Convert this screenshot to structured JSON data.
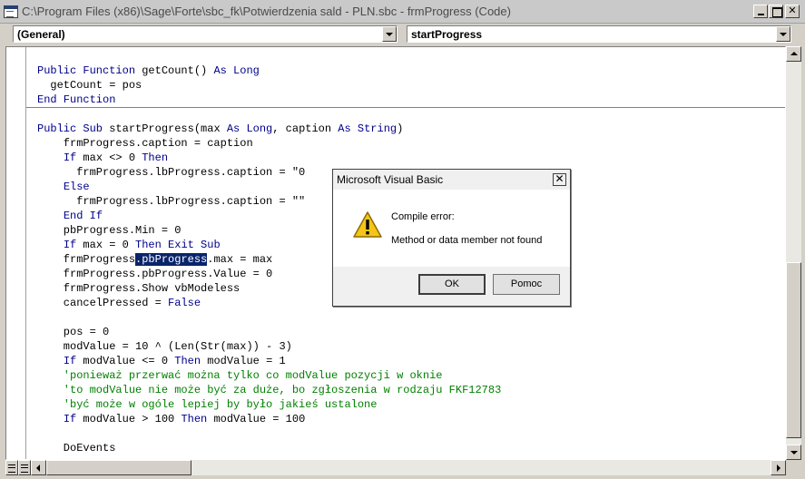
{
  "window": {
    "title": "C:\\Program Files (x86)\\Sage\\Forte\\sbc_fk\\Potwierdzenia sald - PLN.sbc - frmProgress (Code)",
    "buttons": {
      "minimize": "minimize-icon",
      "maximize": "maximize-icon",
      "close": "✕"
    }
  },
  "toolbar": {
    "object_combo": "(General)",
    "procedure_combo": "startProgress"
  },
  "code": {
    "lines": [
      [
        {
          "t": "Public Function ",
          "c": "kw"
        },
        {
          "t": "getCount() "
        },
        {
          "t": "As Long",
          "c": "kw"
        }
      ],
      [
        {
          "t": "  getCount = pos"
        }
      ],
      [
        {
          "t": "End Function",
          "c": "kw"
        }
      ],
      [
        {
          "t": ""
        }
      ],
      [
        {
          "t": "Public Sub ",
          "c": "kw"
        },
        {
          "t": "startProgress(max "
        },
        {
          "t": "As Long",
          "c": "kw"
        },
        {
          "t": ", caption "
        },
        {
          "t": "As String",
          "c": "kw"
        },
        {
          "t": ")"
        }
      ],
      [
        {
          "t": "    frmProgress.caption = caption"
        }
      ],
      [
        {
          "t": "    "
        },
        {
          "t": "If",
          "c": "kw"
        },
        {
          "t": " max <> 0 "
        },
        {
          "t": "Then",
          "c": "kw"
        }
      ],
      [
        {
          "t": "      frmProgress.lbProgress.caption = \"0"
        }
      ],
      [
        {
          "t": "    "
        },
        {
          "t": "Else",
          "c": "kw"
        }
      ],
      [
        {
          "t": "      frmProgress.lbProgress.caption = \"\""
        }
      ],
      [
        {
          "t": "    "
        },
        {
          "t": "End If",
          "c": "kw"
        }
      ],
      [
        {
          "t": "    pbProgress.Min = 0"
        }
      ],
      [
        {
          "t": "    "
        },
        {
          "t": "If",
          "c": "kw"
        },
        {
          "t": " max = 0 "
        },
        {
          "t": "Then Exit Sub",
          "c": "kw"
        }
      ],
      [
        {
          "t": "    frmProgress"
        },
        {
          "t": ".pbProgress",
          "c": "sel"
        },
        {
          "t": ".max = max"
        }
      ],
      [
        {
          "t": "    frmProgress.pbProgress.Value = 0"
        }
      ],
      [
        {
          "t": "    frmProgress.Show vbModeless"
        }
      ],
      [
        {
          "t": "    cancelPressed = "
        },
        {
          "t": "False",
          "c": "kw"
        }
      ],
      [
        {
          "t": ""
        }
      ],
      [
        {
          "t": "    pos = 0"
        }
      ],
      [
        {
          "t": "    modValue = 10 ^ (Len(Str(max)) - 3)"
        }
      ],
      [
        {
          "t": "    "
        },
        {
          "t": "If",
          "c": "kw"
        },
        {
          "t": " modValue <= 0 "
        },
        {
          "t": "Then",
          "c": "kw"
        },
        {
          "t": " modValue = 1"
        }
      ],
      [
        {
          "t": "    'ponieważ przerwać można tylko co modValue pozycji w oknie",
          "c": "cm"
        }
      ],
      [
        {
          "t": "    'to modValue nie może być za duże, bo zgłoszenia w rodzaju FKF12783",
          "c": "cm"
        }
      ],
      [
        {
          "t": "    'być może w ogóle lepiej by było jakieś ustalone",
          "c": "cm"
        }
      ],
      [
        {
          "t": "    "
        },
        {
          "t": "If",
          "c": "kw"
        },
        {
          "t": " modValue > 100 "
        },
        {
          "t": "Then",
          "c": "kw"
        },
        {
          "t": " modValue = 100"
        }
      ],
      [
        {
          "t": ""
        }
      ],
      [
        {
          "t": "    DoEvents"
        }
      ]
    ]
  },
  "dialog": {
    "title": "Microsoft Visual Basic",
    "close": "✕",
    "icon": "warning-icon",
    "line1": "Compile error:",
    "line2": "Method or data member not found",
    "ok_label": "OK",
    "help_label": "Pomoc"
  },
  "colors": {
    "keyword": "#00008b",
    "comment": "#008000",
    "selection": "#0a246a"
  }
}
